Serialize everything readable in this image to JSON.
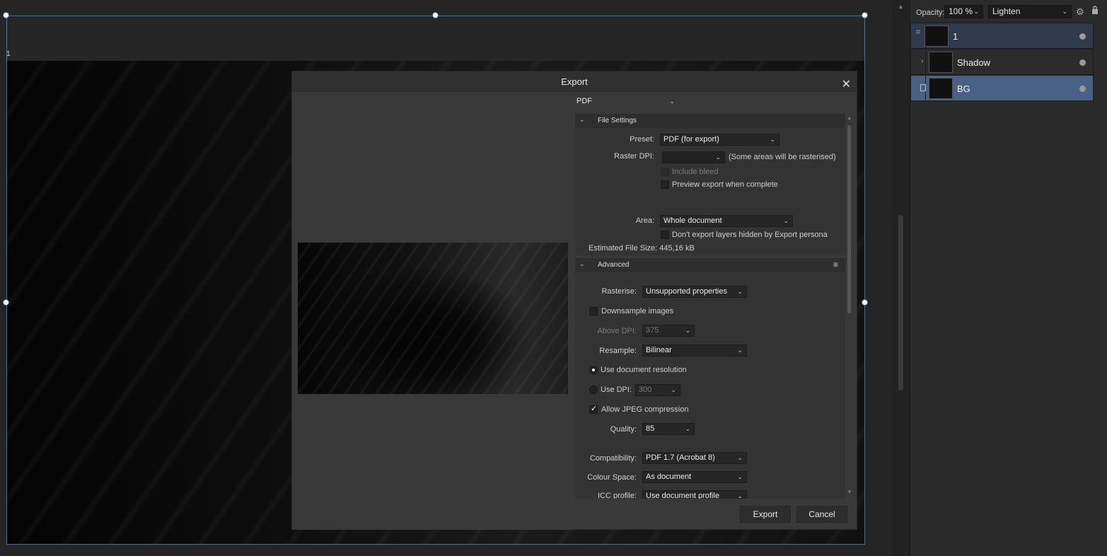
{
  "canvas": {
    "artboard_label": "1"
  },
  "panel": {
    "opacity_label": "Opacity:",
    "opacity_value": "100 %",
    "blend_mode": "Lighten",
    "layers": [
      {
        "name": "1"
      },
      {
        "name": "Shadow"
      },
      {
        "name": "BG"
      }
    ]
  },
  "dialog": {
    "title": "Export",
    "format": "PDF",
    "file_settings": {
      "header": "File Settings",
      "preset_label": "Preset:",
      "preset_value": "PDF (for export)",
      "raster_dpi_label": "Raster DPI:",
      "raster_dpi_value": "",
      "raster_note": "(Some areas will be rasterised)",
      "include_bleed": "Include bleed",
      "preview_export": "Preview export when complete",
      "area_label": "Area:",
      "area_value": "Whole document",
      "dont_export_hidden": "Don't export layers hidden by Export persona",
      "estimated_size": "Estimated File Size: 445,16 kB"
    },
    "advanced": {
      "header": "Advanced",
      "rasterise_label": "Rasterise:",
      "rasterise_value": "Unsupported properties",
      "downsample": "Downsample images",
      "above_dpi_label": "Above DPI:",
      "above_dpi_value": "375",
      "resample_label": "Resample:",
      "resample_value": "Bilinear",
      "use_doc_res": "Use document resolution",
      "use_dpi_label": "Use DPI:",
      "use_dpi_value": "300",
      "allow_jpeg": "Allow JPEG compression",
      "quality_label": "Quality:",
      "quality_value": "85",
      "compat_label": "Compatibility:",
      "compat_value": "PDF 1.7 (Acrobat 8)",
      "colour_space_label": "Colour Space:",
      "colour_space_value": "As document",
      "icc_label": "ICC profile:",
      "icc_value": "Use document profile"
    },
    "export_button": "Export",
    "cancel_button": "Cancel"
  }
}
